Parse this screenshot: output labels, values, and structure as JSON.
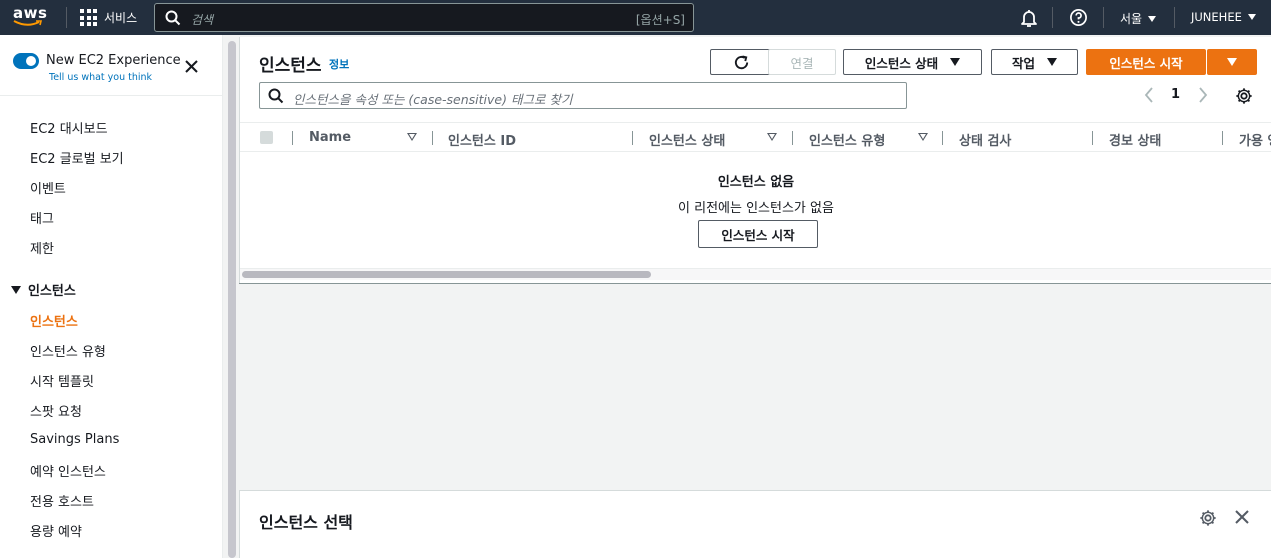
{
  "topnav": {
    "logo_text": "aws",
    "services_label": "서비스",
    "search_placeholder": "검색",
    "search_shortcut": "[옵션+S]",
    "region_label": "서울",
    "user_label": "JUNEHEE"
  },
  "sidebar": {
    "experience_title": "New EC2 Experience",
    "experience_link": "Tell us what you think",
    "items": [
      {
        "label": "EC2 대시보드"
      },
      {
        "label": "EC2 글로벌 보기"
      },
      {
        "label": "이벤트"
      },
      {
        "label": "태그"
      },
      {
        "label": "제한"
      }
    ],
    "section_instances": "인스턴스",
    "instance_items": [
      {
        "label": "인스턴스",
        "active": true
      },
      {
        "label": "인스턴스 유형"
      },
      {
        "label": "시작 템플릿"
      },
      {
        "label": "스팟 요청"
      },
      {
        "label": "Savings Plans"
      },
      {
        "label": "예약 인스턴스"
      },
      {
        "label": "전용 호스트"
      },
      {
        "label": "용량 예약"
      }
    ]
  },
  "main": {
    "title": "인스턴스",
    "info_link": "정보",
    "connect_label": "연결",
    "instance_state_label": "인스턴스 상태",
    "actions_label": "작업",
    "launch_label": "인스턴스 시작",
    "filter_placeholder": "인스턴스을 속성 또는 (case-sensitive) 태그로 찾기",
    "page_number": "1",
    "columns": [
      "Name",
      "인스턴스 ID",
      "인스턴스 상태",
      "인스턴스 유형",
      "상태 검사",
      "경보 상태",
      "가용 영"
    ],
    "empty_title": "인스턴스 없음",
    "empty_subtitle": "이 리전에는 인스턴스가 없음",
    "empty_button": "인스턴스 시작"
  },
  "details": {
    "title": "인스턴스 선택"
  },
  "colors": {
    "nav_bg": "#232f3e",
    "accent_orange": "#ec7211",
    "link_blue": "#0073bb"
  }
}
